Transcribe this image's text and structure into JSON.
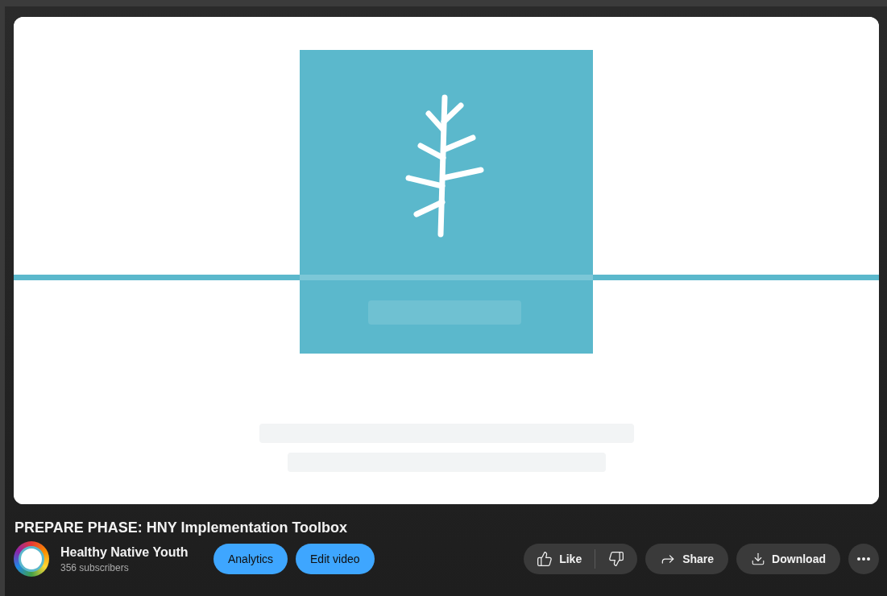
{
  "title": "PREPARE PHASE: HNY Implementation Toolbox",
  "channel": {
    "name": "Healthy Native Youth",
    "subscribers": "356 subscribers"
  },
  "owner_buttons": [
    "Analytics",
    "Edit video"
  ],
  "actions": {
    "like": "Like",
    "share": "Share",
    "download": "Download"
  }
}
